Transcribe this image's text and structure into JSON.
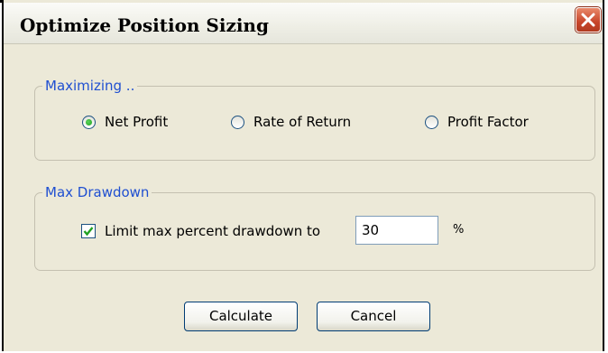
{
  "window": {
    "title": "Optimize Position Sizing"
  },
  "maximizing": {
    "legend": "Maximizing ..",
    "options": [
      {
        "label": "Net Profit",
        "selected": true
      },
      {
        "label": "Rate of Return",
        "selected": false
      },
      {
        "label": "Profit Factor",
        "selected": false
      }
    ]
  },
  "drawdown": {
    "legend": "Max Drawdown",
    "limit_label": "Limit max percent drawdown to",
    "limit_checked": true,
    "value": "30",
    "unit": "%"
  },
  "buttons": {
    "calculate": "Calculate",
    "cancel": "Cancel"
  },
  "colors": {
    "legend_text": "#1f4fd1",
    "dialog_bg": "#ece9d8",
    "close_button": "#c8452a"
  }
}
